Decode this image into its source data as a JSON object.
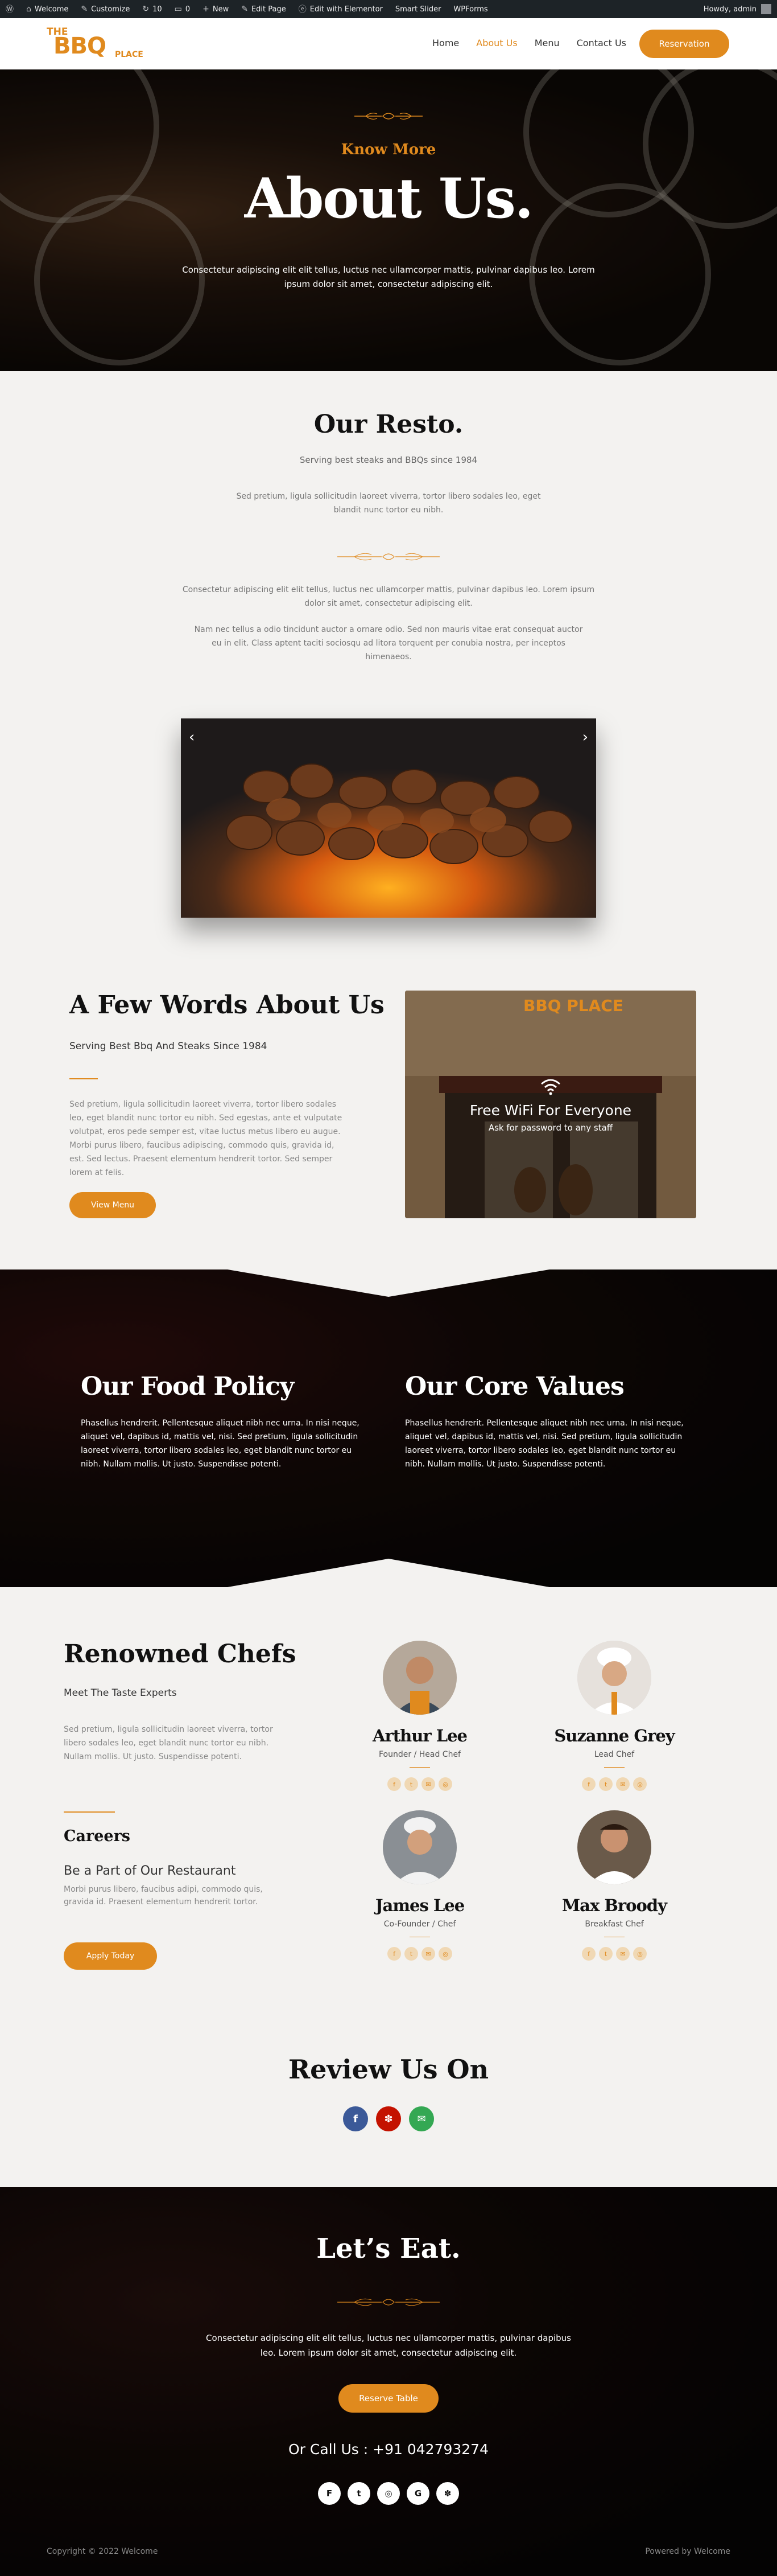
{
  "admin_bar": {
    "items": [
      "Welcome",
      "Customize",
      "10",
      "0",
      "New",
      "Edit Page",
      "Edit with Elementor",
      "Smart Slider",
      "WPForms"
    ],
    "greeting": "Howdy, admin"
  },
  "header": {
    "logo": {
      "line1": "THE",
      "line2": "BBQ",
      "line3": "PLACE"
    },
    "nav": [
      "Home",
      "About Us",
      "Menu",
      "Contact Us"
    ],
    "active_nav": "About Us",
    "cta": "Reservation"
  },
  "hero": {
    "kicker": "Know More",
    "title": "About Us.",
    "text": "Consectetur adipiscing elit elit tellus, luctus nec ullamcorper mattis, pulvinar dapibus leo. Lorem ipsum dolor sit amet, consectetur adipiscing elit."
  },
  "resto": {
    "title": "Our Resto.",
    "subtitle": "Serving best steaks and BBQs since 1984",
    "text1": "Sed pretium, ligula sollicitudin laoreet viverra, tortor libero sodales leo, eget blandit nunc tortor eu nibh.",
    "text2": "Consectetur adipiscing elit elit tellus, luctus nec ullamcorper mattis, pulvinar dapibus leo. Lorem ipsum dolor sit amet, consectetur adipiscing elit.",
    "text3": "Nam nec tellus a odio tincidunt auctor a ornare odio. Sed non mauris vitae erat consequat auctor eu in elit. Class aptent taciti sociosqu ad litora torquent per conubia nostra, per inceptos himenaeos."
  },
  "slider": {
    "prev": "‹",
    "next": "›"
  },
  "about": {
    "title": "A Few Words About Us",
    "subtitle": "Serving Best Bbq And Steaks Since 1984",
    "text": "Sed pretium, ligula sollicitudin laoreet viverra, tortor libero sodales leo, eget blandit nunc tortor eu nibh. Sed egestas, ante et vulputate volutpat, eros pede semper est, vitae luctus metus libero eu augue. Morbi purus libero, faucibus adipiscing, commodo quis, gravida id, est. Sed lectus. Praesent elementum hendrerit tortor. Sed semper lorem at felis.",
    "button": "View Menu",
    "wifi_title": "Free WiFi For Everyone",
    "wifi_sub": "Ask for password to any staff",
    "sign": "BBQ PLACE"
  },
  "policy": {
    "food_title": "Our Food Policy",
    "food_text": "Phasellus hendrerit. Pellentesque aliquet nibh nec urna. In nisi neque, aliquet vel, dapibus id, mattis vel, nisi. Sed pretium, ligula sollicitudin laoreet viverra, tortor libero sodales leo, eget blandit nunc tortor eu nibh. Nullam mollis. Ut justo. Suspendisse potenti.",
    "values_title": "Our Core Values",
    "values_text": "Phasellus hendrerit. Pellentesque aliquet nibh nec urna. In nisi neque, aliquet vel, dapibus id, mattis vel, nisi. Sed pretium, ligula sollicitudin laoreet viverra, tortor libero sodales leo, eget blandit nunc tortor eu nibh. Nullam mollis. Ut justo. Suspendisse potenti."
  },
  "chefs": {
    "title": "Renowned Chefs",
    "subtitle": "Meet The Taste Experts",
    "text": "Sed pretium, ligula sollicitudin laoreet viverra, tortor libero sodales leo, eget blandit nunc tortor eu nibh. Nullam mollis. Ut justo. Suspendisse potenti.",
    "careers_title": "Careers",
    "careers_sub": "Be a Part of Our Restaurant",
    "careers_text": "Morbi purus libero, faucibus adipi, commodo quis, gravida id. Praesent elementum hendrerit tortor.",
    "apply": "Apply Today",
    "list": [
      {
        "name": "Arthur Lee",
        "role": "Founder / Head Chef"
      },
      {
        "name": "Suzanne Grey",
        "role": "Lead Chef"
      },
      {
        "name": "James Lee",
        "role": "Co-Founder / Chef"
      },
      {
        "name": "Max Broody",
        "role": "Breakfast Chef"
      }
    ],
    "social_icons": [
      "facebook-icon",
      "twitter-icon",
      "email-icon",
      "instagram-icon"
    ]
  },
  "review": {
    "title": "Review Us On",
    "icons": [
      "facebook-icon",
      "yelp-icon",
      "tripadvisor-icon"
    ],
    "colors": {
      "facebook": "#3b5998",
      "yelp": "#c41200",
      "tripadvisor": "#34a853"
    }
  },
  "footer": {
    "title": "Let’s Eat.",
    "text": "Consectetur adipiscing elit elit tellus, luctus nec ullamcorper mattis, pulvinar dapibus leo. Lorem ipsum dolor sit amet, consectetur adipiscing elit.",
    "button": "Reserve Table",
    "call": "Or Call Us : +91 042793274",
    "icons": [
      "foursquare-icon",
      "twitter-icon",
      "instagram-icon",
      "google-icon",
      "yelp-icon"
    ],
    "copyright": "Copyright © 2022 Welcome",
    "powered": "Powered by Welcome"
  },
  "colors": {
    "accent": "#e08a1e",
    "dark": "#111111",
    "admin_bar": "#1d2327"
  }
}
